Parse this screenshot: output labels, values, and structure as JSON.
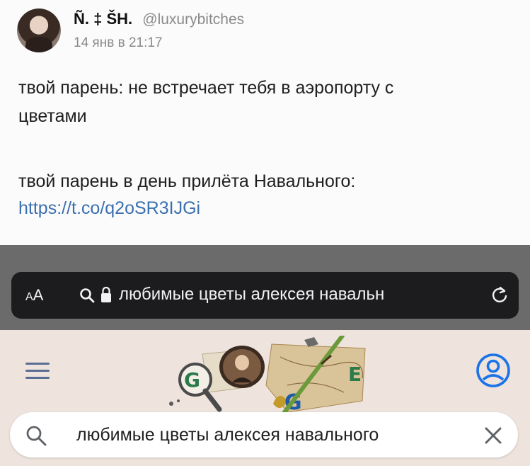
{
  "post": {
    "author_name": "Ñ. ‡ ŠH.",
    "author_handle": "@luxurybitches",
    "date": "14 янв в 21:17",
    "line1": "твой парень: не встречает тебя в аэропорту с",
    "line2": "цветами",
    "line3": "твой парень в день прилёта Навального:",
    "link": "https://t.co/q2oSR3IJGi"
  },
  "browser": {
    "text_size_label_small": "A",
    "text_size_label_large": "A",
    "url_text": "любимые цветы алексея навальн"
  },
  "google": {
    "search_query": "любимые цветы алексея навального",
    "doodle_letters": [
      "G",
      "G",
      "E"
    ]
  },
  "colors": {
    "link": "#3a6fb0",
    "browser_frame": "#6b6b6b",
    "url_bar": "#1c1c1e",
    "google_bg": "#eee3dd",
    "google_blue": "#1a73e8"
  }
}
